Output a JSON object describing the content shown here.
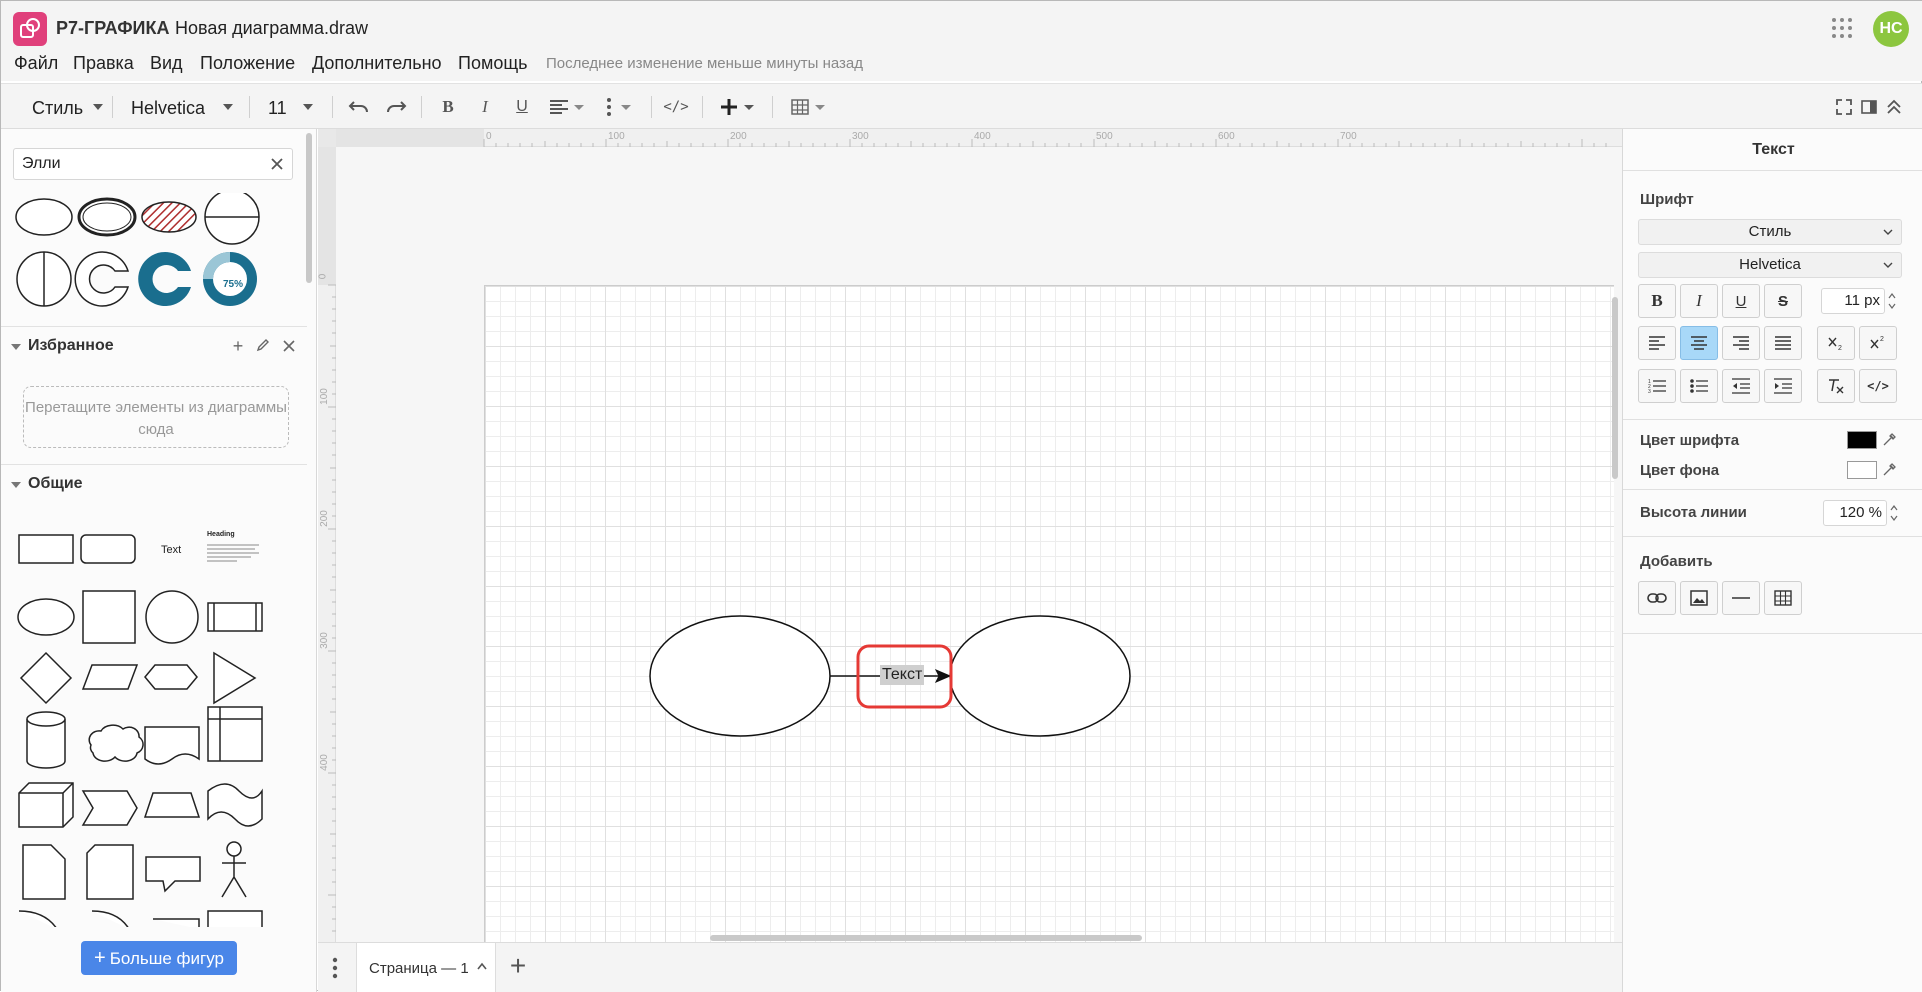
{
  "app": {
    "name": "Р7-ГРАФИКА",
    "document_title": "Новая диаграмма.draw",
    "user_initials": "НС",
    "avatar_color": "#8cc63f",
    "brand_color": "#e0407b"
  },
  "menu": {
    "items": [
      "Файл",
      "Правка",
      "Вид",
      "Положение",
      "Дополнительно",
      "Помощь"
    ],
    "last_change": "Последнее изменение меньше минуты назад"
  },
  "toolbar": {
    "style_label": "Стиль",
    "font_family": "Helvetica",
    "font_size": "11",
    "bold": "B",
    "italic": "I",
    "underline": "U",
    "html_tag": "</>"
  },
  "sidebar": {
    "search": {
      "value": "Элли",
      "placeholder": ""
    },
    "donut_label": "75%",
    "favorites": {
      "title": "Избранное",
      "dropzone": "Перетащите элементы из диаграммы сюда"
    },
    "general": {
      "title": "Общие",
      "text_shape_label": "Text",
      "heading_shape_label": "Heading"
    },
    "more_shapes": "Больше фигур"
  },
  "canvas": {
    "ruler_top": [
      "0",
      "100",
      "200",
      "300",
      "400",
      "500",
      "600",
      "700"
    ],
    "ruler_left": [
      "0",
      "100",
      "200",
      "300",
      "400"
    ],
    "edge_label": "Текст",
    "highlight_color": "#e53935"
  },
  "pages": {
    "tabs": [
      "Страница — 1"
    ]
  },
  "panel": {
    "title": "Текст",
    "font_section": "Шрифт",
    "style_select": "Стиль",
    "font_select": "Helvetica",
    "font_size": "11 px",
    "font_color_label": "Цвет шрифта",
    "font_color": "#000000",
    "bg_color_label": "Цвет фона",
    "bg_color": "#ffffff",
    "line_height_label": "Высота линии",
    "line_height": "120 %",
    "add_section": "Добавить"
  }
}
